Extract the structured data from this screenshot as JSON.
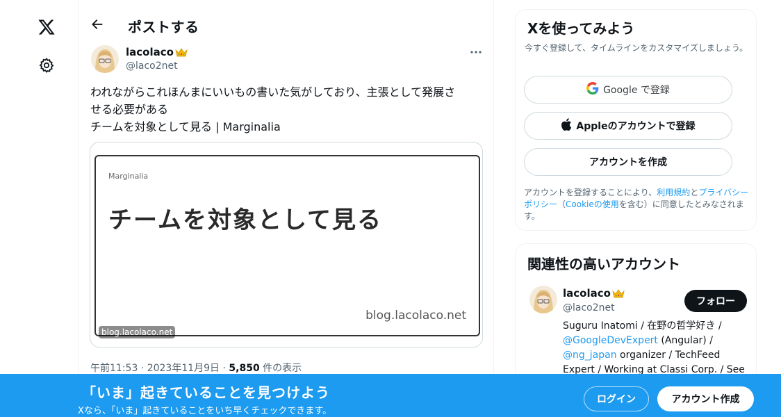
{
  "nav": {
    "logo_icon": "x-logo-icon",
    "settings_icon": "gear-icon"
  },
  "header": {
    "title": "ポストする",
    "back_icon": "arrow-left-icon"
  },
  "post": {
    "author_name": "lacolaco",
    "author_handle": "@laco2net",
    "text_line1": "われながらこれほんまにいいもの書いた気がしており、主張として発展さ",
    "text_line2": "せる必要がある",
    "text_line3": "チームを対象として見る | Marginalia",
    "card": {
      "site_name": "Marginalia",
      "headline": "チームを対象として見る",
      "image_domain": "blog.lacolaco.net",
      "domain_badge": "blog.lacolaco.net"
    },
    "timestamp": "午前11:53 · 2023年11月9日 · ",
    "views_count": "5,850",
    "views_label": " 件の表示"
  },
  "signup_box": {
    "title": "Xを使ってみよう",
    "subtitle": "今すぐ登録して、タイムラインをカスタマイズしましょう。",
    "google_button": "Google で登録",
    "apple_button": "Appleのアカウントで登録",
    "create_button": "アカウントを作成",
    "terms_prefix": "アカウントを登録することにより、",
    "terms_link": "利用規約",
    "terms_and": "と",
    "privacy_link": "プライバシーポリシー",
    "terms_open": "（",
    "cookie_link": "Cookieの使用",
    "terms_suffix": "を含む）に同意したとみなされます。"
  },
  "related": {
    "title": "関連性の高いアカウント",
    "name": "lacolaco",
    "handle": "@laco2net",
    "follow_button": "フォロー",
    "bio_line1": "Suguru Inatomi / 在野の哲学好き /",
    "bio_link1": "@GoogleDevExpert",
    "bio_line2_rest": " (Angular) /",
    "bio_link2": "@ng_japan",
    "bio_line3_rest": " organizer / TechFeed",
    "bio_line4": "Expert / Working at Classi Corp. / See"
  },
  "bottom_bar": {
    "title": "「いま」起きていることを見つけよう",
    "subtitle": "Xなら、「いま」起きていることをいち早くチェックできます。",
    "login_button": "ログイン",
    "signup_button": "アカウント作成",
    "color": "#1d9bf0"
  }
}
